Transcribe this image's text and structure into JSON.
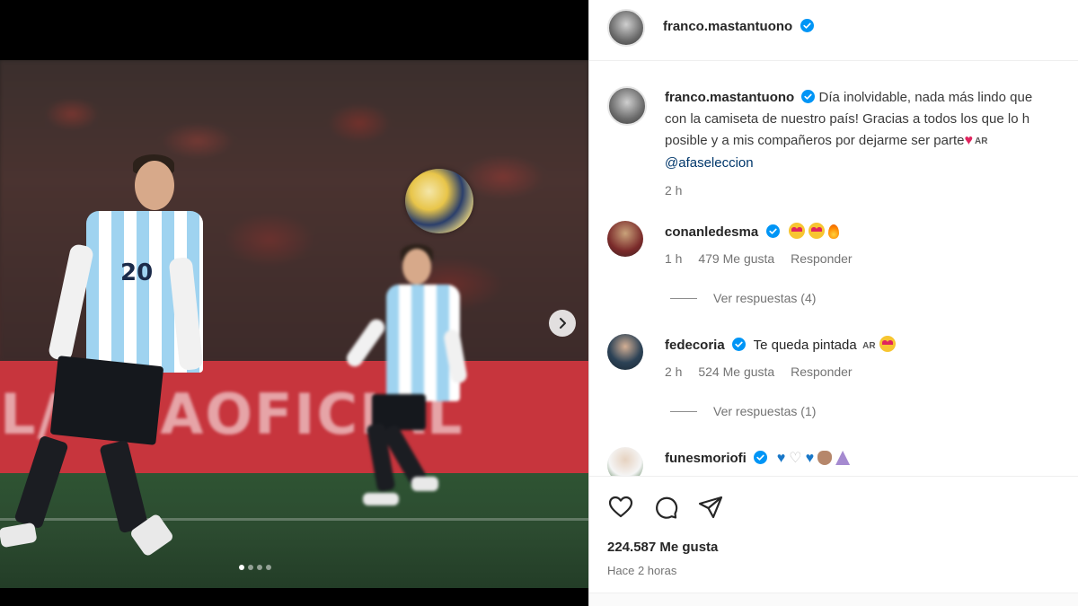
{
  "post": {
    "username": "franco.mastantuono",
    "verified": true,
    "caption_line1": "Día inolvidable, nada más lindo que",
    "caption_line2": "con la camiseta de nuestro país! Gracias a todos los que lo h",
    "caption_line3": "posible y a mis compañeros por dejarme ser parte",
    "caption_flag": "AR",
    "caption_mention": "@afaseleccion",
    "caption_time": "2 h",
    "likes_label": "224.587 Me gusta",
    "time_ago": "Hace 2 horas"
  },
  "media": {
    "banner_text": "L/TE  AOFICIAL",
    "jersey_number": "20",
    "carousel_total": 4,
    "carousel_active": 1
  },
  "comments": [
    {
      "username": "conanledesma",
      "verified": true,
      "text": "",
      "emojis": [
        "heart-eyes",
        "heart-eyes",
        "fire"
      ],
      "time": "1 h",
      "likes": "479 Me gusta",
      "reply_label": "Responder",
      "view_replies": "Ver respuestas (4)"
    },
    {
      "username": "fedecoria",
      "verified": true,
      "text": "Te queda pintada",
      "flag": "AR",
      "emojis": [
        "heart-eyes"
      ],
      "time": "2 h",
      "likes": "524 Me gusta",
      "reply_label": "Responder",
      "view_replies": "Ver respuestas (1)"
    },
    {
      "username": "funesmoriofi",
      "verified": true,
      "emojis": [
        "blue-heart",
        "white-heart",
        "blue-heart",
        "clap",
        "pray"
      ]
    }
  ],
  "icons": {
    "like": "heart-icon",
    "comment": "comment-icon",
    "share": "share-icon",
    "verified": "verified-badge-icon",
    "next": "chevron-right-icon"
  },
  "colors": {
    "verified_blue": "#0095f6",
    "mention": "#00376b",
    "muted": "#737373"
  }
}
